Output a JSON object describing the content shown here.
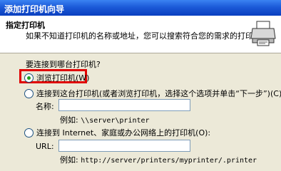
{
  "window": {
    "title": "添加打印机向导"
  },
  "header": {
    "title": "指定打印机",
    "description": "如果不知道打印机的名称或地址，您可以搜索符合您的需求的打印机。",
    "icon": "printer-icon"
  },
  "form": {
    "question": "要连接到哪台打印机?",
    "options": [
      {
        "label": "浏览打印机(W)",
        "selected": true
      },
      {
        "label": "连接到这台打印机(或者浏览打印机，选择这个选项并单击“下一步”)(C):",
        "selected": false
      },
      {
        "label": "连接到 Internet、家庭或办公网络上的打印机(O):",
        "selected": false
      }
    ],
    "name_field": {
      "label": "名称:",
      "value": "",
      "example_prefix": "例如:",
      "example_value": "\\\\server\\printer"
    },
    "url_field": {
      "label": "URL:",
      "value": "",
      "example_prefix": "例如:",
      "example_value": "http://server/printers/myprinter/.printer"
    }
  },
  "colors": {
    "highlight": "#e00000",
    "title_bar": "#0a3fbf"
  }
}
